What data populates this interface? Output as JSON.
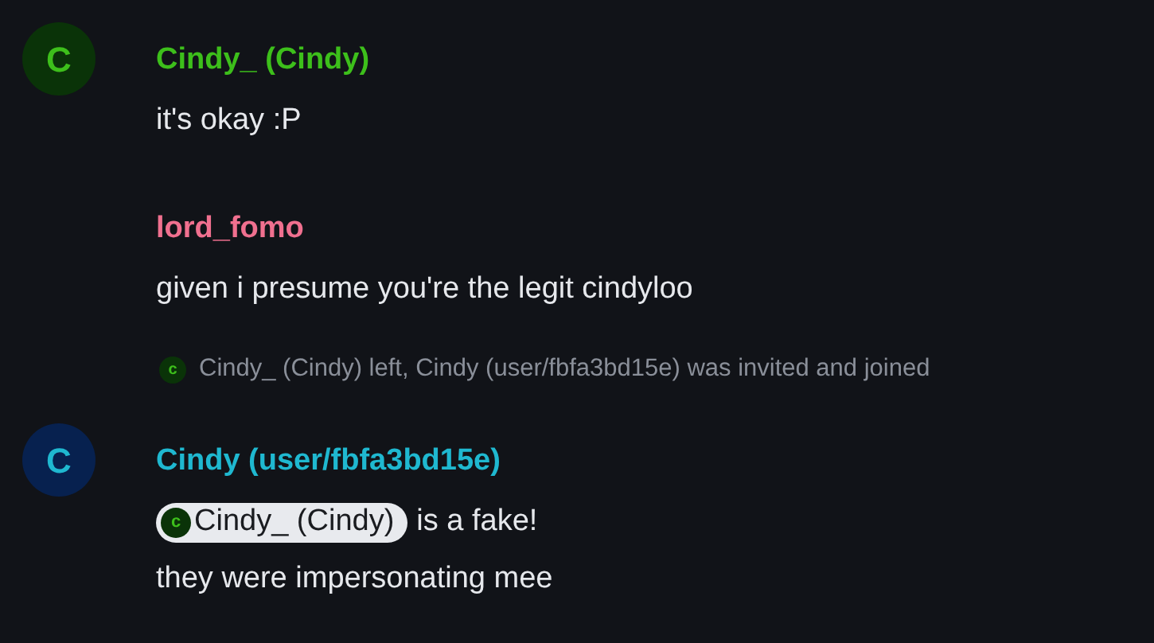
{
  "timeline": [
    {
      "kind": "message",
      "sender": "Cindy_ (Cindy)",
      "color": "#3dbf1b",
      "avatar": {
        "letter": "C",
        "color": "#0a3308"
      },
      "lines": [
        [
          {
            "kind": "text",
            "text": "it's okay :P"
          }
        ]
      ]
    },
    {
      "kind": "message",
      "sender": "lord_fomo",
      "color": "#f0708f",
      "lines": [
        [
          {
            "kind": "text",
            "text": "given i presume you're the legit cindyloo"
          }
        ]
      ]
    },
    {
      "kind": "event",
      "avatar": {
        "letter": "c",
        "color": "#0a3308"
      },
      "text": "Cindy_ (Cindy) left, Cindy (user/fbfa3bd15e) was invited and joined"
    },
    {
      "kind": "message",
      "sender": "Cindy (user/fbfa3bd15e)",
      "color": "#1fb8d0",
      "avatar": {
        "letter": "C",
        "color": "#07214f"
      },
      "lines": [
        [
          {
            "kind": "pill",
            "label": "Cindy_ (Cindy)",
            "avatar": {
              "letter": "c",
              "color": "#0a3308"
            }
          },
          {
            "kind": "text",
            "text": "is a fake!"
          }
        ],
        [
          {
            "kind": "text",
            "text": "they were impersonating mee"
          }
        ]
      ]
    }
  ]
}
